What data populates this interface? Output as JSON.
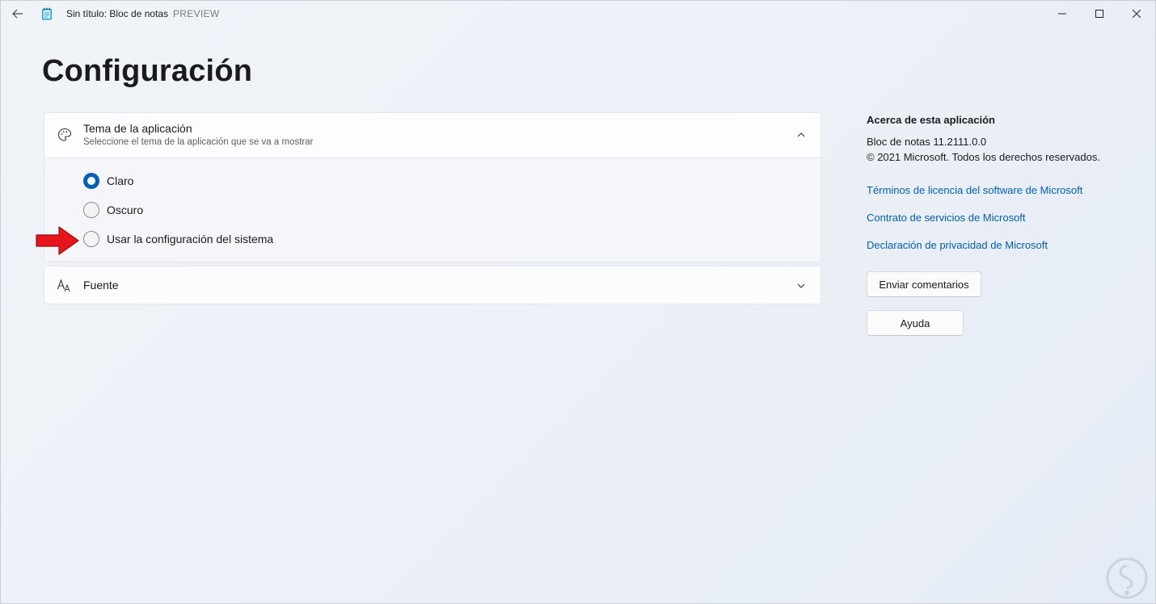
{
  "window": {
    "title": "Sin título: Bloc de notas",
    "preview_tag": "PREVIEW",
    "icons": {
      "back": "back-arrow-icon",
      "app": "notepad-icon",
      "minimize": "minimize-icon",
      "maximize": "maximize-icon",
      "close": "close-icon"
    }
  },
  "page": {
    "title": "Configuración"
  },
  "theme_section": {
    "title": "Tema de la aplicación",
    "subtitle": "Seleccione el tema de la aplicación que se va a mostrar",
    "icon": "palette-icon",
    "expanded": true,
    "options": [
      {
        "label": "Claro",
        "checked": true
      },
      {
        "label": "Oscuro",
        "checked": false
      },
      {
        "label": "Usar la configuración del sistema",
        "checked": false
      }
    ]
  },
  "font_section": {
    "title": "Fuente",
    "icon": "font-icon",
    "expanded": false
  },
  "about": {
    "title": "Acerca de esta aplicación",
    "version": "Bloc de notas 11.2111.0.0",
    "copyright": "© 2021 Microsoft. Todos los derechos reservados.",
    "links": [
      "Términos de licencia del software de Microsoft",
      "Contrato de servicios de Microsoft",
      "Declaración de privacidad de Microsoft"
    ],
    "feedback_button": "Enviar comentarios",
    "help_button": "Ayuda"
  },
  "colors": {
    "accent": "#005fb8",
    "annotation_arrow": "#e8141b"
  }
}
